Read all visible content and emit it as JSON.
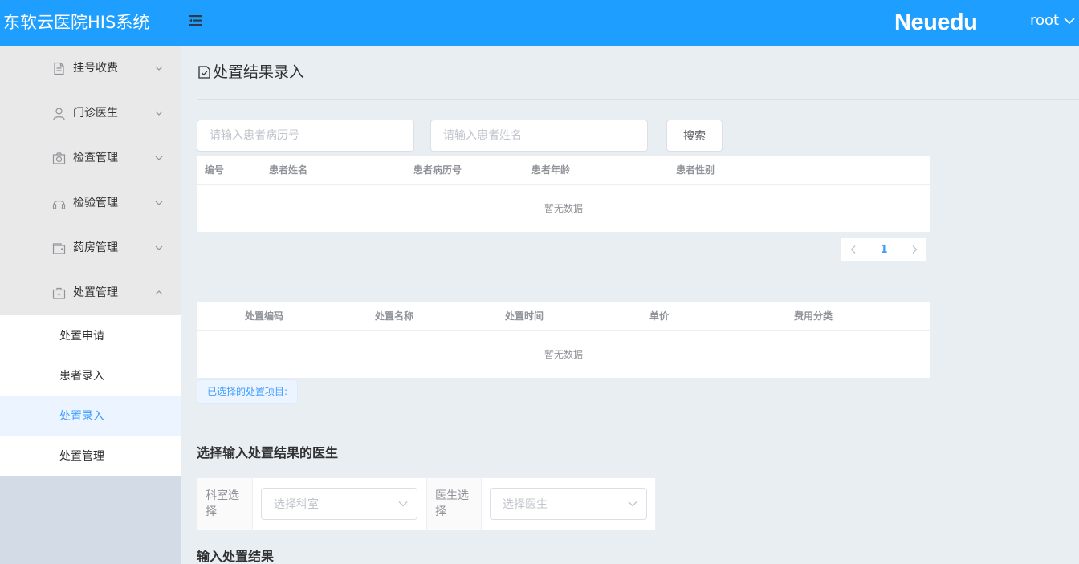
{
  "header": {
    "app_title": "东软云医院HIS系统",
    "brand": "Neuedu",
    "user": "root"
  },
  "sidebar": {
    "groups": [
      {
        "label": "挂号收费",
        "icon": "document-icon"
      },
      {
        "label": "门诊医生",
        "icon": "user-icon"
      },
      {
        "label": "检查管理",
        "icon": "camera-icon"
      },
      {
        "label": "检验管理",
        "icon": "headset-icon"
      },
      {
        "label": "药房管理",
        "icon": "wallet-icon"
      },
      {
        "label": "处置管理",
        "icon": "first-aid-kit-icon"
      }
    ],
    "sub_items": [
      {
        "label": "处置申请"
      },
      {
        "label": "患者录入"
      },
      {
        "label": "处置录入",
        "active": true
      },
      {
        "label": "处置管理"
      }
    ]
  },
  "main": {
    "page_title": "处置结果录入",
    "search": {
      "record_placeholder": "请输入患者病历号",
      "name_placeholder": "请输入患者姓名",
      "button": "搜索"
    },
    "patient_table": {
      "columns": [
        "编号",
        "患者姓名",
        "患者病历号",
        "患者年龄",
        "患者性别"
      ],
      "empty_text": "暂无数据"
    },
    "pagination": {
      "current_page": "1"
    },
    "treatment_table": {
      "columns": [
        "处置编码",
        "处置名称",
        "处置时间",
        "单价",
        "费用分类"
      ],
      "empty_text": "暂无数据"
    },
    "selected_label": "已选择的处置项目:",
    "doctor_section": {
      "title": "选择输入处置结果的医生",
      "dept_label": "科室选择",
      "dept_placeholder": "选择科室",
      "doctor_label": "医生选择",
      "doctor_placeholder": "选择医生"
    },
    "result_section": {
      "title": "输入处置结果"
    }
  },
  "colors": {
    "header_bg": "#1e9fff",
    "active": "#409eff",
    "main_bg": "#e9eef3"
  }
}
